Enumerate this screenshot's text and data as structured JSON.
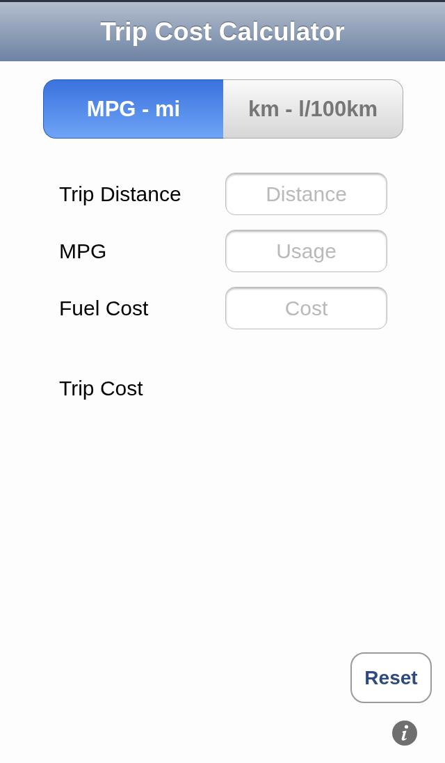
{
  "navigation_bar": {
    "title": "Trip Cost Calculator"
  },
  "unit_segments": [
    {
      "label": "MPG - mi",
      "selected": true
    },
    {
      "label": "km - l/100km",
      "selected": false
    }
  ],
  "fields": [
    {
      "label": "Trip Distance",
      "placeholder": "Distance"
    },
    {
      "label": "MPG",
      "placeholder": "Usage"
    },
    {
      "label": "Fuel Cost",
      "placeholder": "Cost"
    }
  ],
  "result": {
    "label": "Trip Cost"
  },
  "buttons": [
    {
      "label": "Reset"
    }
  ]
}
